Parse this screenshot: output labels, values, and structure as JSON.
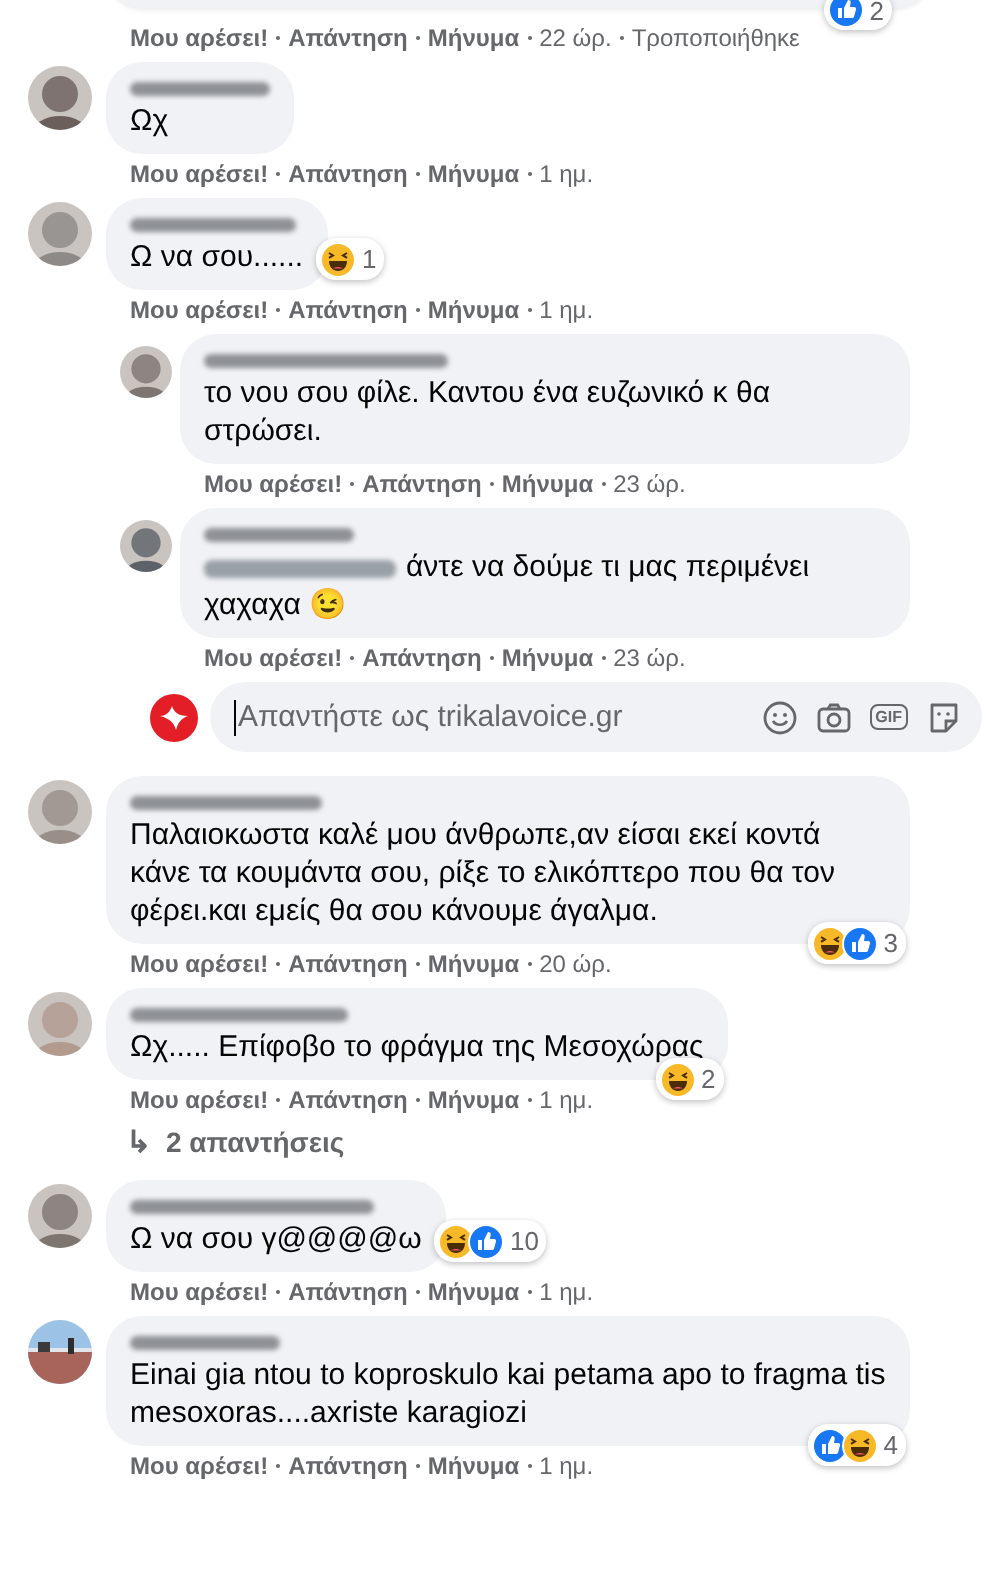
{
  "cut_comment": {
    "reactions": [
      {
        "kind": "like"
      }
    ],
    "reaction_count": "2",
    "actions": [
      "Μου αρέσει!",
      "Απάντηση",
      "Μήνυμα"
    ],
    "time": "22 ώρ.",
    "edited": "Τροποποιήθηκε"
  },
  "comments": [
    {
      "avatar": {
        "kind": "person"
      },
      "text": "Ωχ",
      "actions": [
        "Μου αρέσει!",
        "Απάντηση",
        "Μήνυμα"
      ],
      "time": "1 ημ."
    },
    {
      "avatar": {
        "kind": "person"
      },
      "text": "Ω να σου......",
      "reactions": [
        {
          "kind": "haha"
        }
      ],
      "reaction_count": "1",
      "actions": [
        "Μου αρέσει!",
        "Απάντηση",
        "Μήνυμα"
      ],
      "time": "1 ημ.",
      "children": [
        {
          "avatar": {
            "kind": "person"
          },
          "text": "το νου σου φίλε. Καντου ένα ευζωνικό κ θα στρώσει.",
          "actions": [
            "Μου αρέσει!",
            "Απάντηση",
            "Μήνυμα"
          ],
          "time": "23 ώρ."
        },
        {
          "avatar": {
            "kind": "person"
          },
          "mention_blurred": true,
          "text": "άντε να δούμε τι μας περιμένει χαχαχα 😉",
          "actions": [
            "Μου αρέσει!",
            "Απάντηση",
            "Μήνυμα"
          ],
          "time": "23 ώρ."
        }
      ],
      "reply_box": {
        "placeholder": "Απαντήστε ως trikalavoice.gr",
        "gif_label": "GIF"
      }
    },
    {
      "avatar": {
        "kind": "person"
      },
      "text": "Παλαιοκωστα καλέ μου άνθρωπε,αν είσαι εκεί κοντά κάνε τα κουμάντα σου, ρίξε το ελικόπτερο που θα τον φέρει.και εμείς θα σου κάνουμε άγαλμα.",
      "reactions": [
        {
          "kind": "haha"
        },
        {
          "kind": "like"
        }
      ],
      "reaction_count": "3",
      "actions": [
        "Μου αρέσει!",
        "Απάντηση",
        "Μήνυμα"
      ],
      "time": "20 ώρ."
    },
    {
      "avatar": {
        "kind": "person"
      },
      "text": "Ωχ..... Επίφοβο το φράγμα της Μεσοχώρας",
      "reactions": [
        {
          "kind": "haha"
        }
      ],
      "reaction_count": "2",
      "actions": [
        "Μου αρέσει!",
        "Απάντηση",
        "Μήνυμα"
      ],
      "time": "1 ημ.",
      "replies_link": {
        "icon": "↳",
        "label": "2 απαντήσεις"
      }
    },
    {
      "avatar": {
        "kind": "person"
      },
      "text": "Ω να σου γ@@@@ω",
      "reactions": [
        {
          "kind": "haha"
        },
        {
          "kind": "like"
        }
      ],
      "reaction_count": "10",
      "actions": [
        "Μου αρέσει!",
        "Απάντηση",
        "Μήνυμα"
      ],
      "time": "1 ημ."
    },
    {
      "avatar": {
        "kind": "picture"
      },
      "text": "Einai gia ntou to koproskulo kai petama apo to fragma tis mesoxoras....axriste karagiozi",
      "reactions": [
        {
          "kind": "like"
        },
        {
          "kind": "haha"
        }
      ],
      "reaction_count": "4",
      "actions": [
        "Μου αρέσει!",
        "Απάντηση",
        "Μήνυμα"
      ],
      "time": "1 ημ."
    }
  ]
}
